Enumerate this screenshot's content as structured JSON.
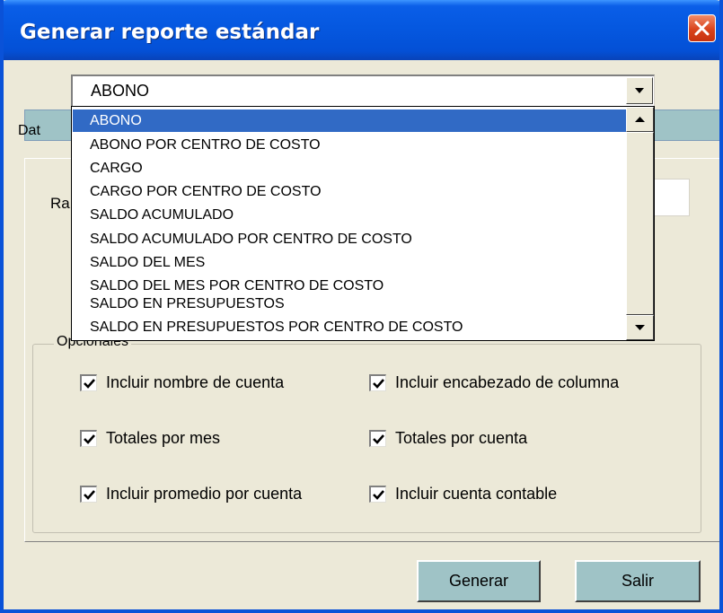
{
  "window": {
    "title": "Generar reporte estándar"
  },
  "combo": {
    "selected_value": "ABONO",
    "options": [
      "ABONO",
      "ABONO POR CENTRO DE COSTO",
      "CARGO",
      "CARGO POR CENTRO DE COSTO",
      "SALDO ACUMULADO",
      "SALDO ACUMULADO POR CENTRO DE COSTO",
      "SALDO DEL MES",
      "SALDO DEL MES POR CENTRO DE COSTO",
      "SALDO EN PRESUPUESTOS",
      "SALDO EN PRESUPUESTOS POR CENTRO DE COSTO"
    ]
  },
  "tab": {
    "label_partial": "Dat"
  },
  "rango": {
    "label_partial": "Ra"
  },
  "opcionales": {
    "legend": "Opcionales",
    "checks": [
      {
        "label": "Incluir nombre de cuenta",
        "checked": true
      },
      {
        "label": "Incluir encabezado de columna",
        "checked": true
      },
      {
        "label": "Totales por mes",
        "checked": true
      },
      {
        "label": "Totales por cuenta",
        "checked": true
      },
      {
        "label": "Incluir promedio por cuenta",
        "checked": true
      },
      {
        "label": "Incluir cuenta contable",
        "checked": true
      }
    ]
  },
  "buttons": {
    "generar": "Generar",
    "salir": "Salir"
  },
  "icons": {
    "close": "close-icon",
    "combo_arrow": "chevron-down-icon",
    "scroll_up": "arrow-up-icon",
    "scroll_down": "arrow-down-icon",
    "check": "check-icon"
  },
  "colors": {
    "titlebar": "#0558e0",
    "selection": "#316ac5",
    "button_face": "#9fc3c6",
    "dialog_bg": "#ece9d8",
    "close_button": "#d9431c"
  }
}
